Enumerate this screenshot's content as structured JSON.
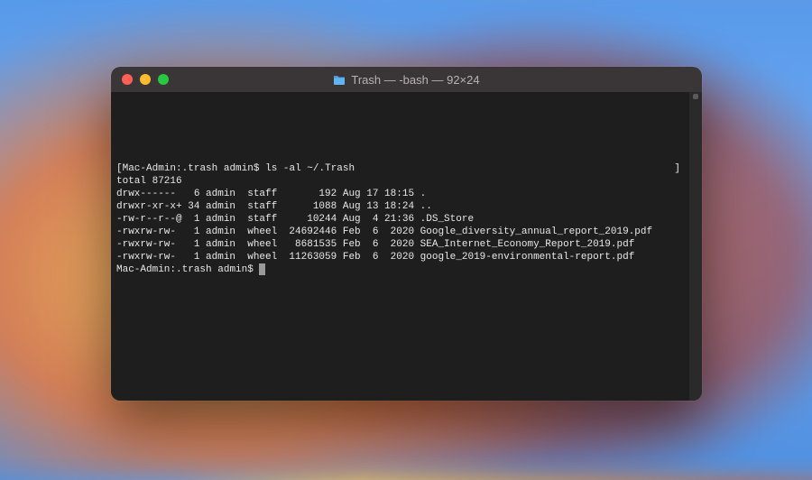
{
  "window": {
    "title": "Trash — -bash — 92×24",
    "folder_icon": "folder-icon"
  },
  "session": {
    "prompt_host": "Mac-Admin",
    "prompt_cwd": ".trash",
    "prompt_user": "admin",
    "prompt_sep": "$",
    "command": "ls -al ~/.Trash",
    "total_line": "total 87216",
    "rows": [
      {
        "perm": "drwx------",
        "links": "6",
        "owner": "admin",
        "group": "staff",
        "size": "192",
        "date": "Aug 17 18:15",
        "name": "."
      },
      {
        "perm": "drwxr-xr-x+",
        "links": "34",
        "owner": "admin",
        "group": "staff",
        "size": "1088",
        "date": "Aug 13 18:24",
        "name": ".."
      },
      {
        "perm": "-rw-r--r--@",
        "links": "1",
        "owner": "admin",
        "group": "staff",
        "size": "10244",
        "date": "Aug  4 21:36",
        "name": ".DS_Store"
      },
      {
        "perm": "-rwxrw-rw-",
        "links": "1",
        "owner": "admin",
        "group": "wheel",
        "size": "24692446",
        "date": "Feb  6  2020",
        "name": "Google_diversity_annual_report_2019.pdf"
      },
      {
        "perm": "-rwxrw-rw-",
        "links": "1",
        "owner": "admin",
        "group": "wheel",
        "size": "8681535",
        "date": "Feb  6  2020",
        "name": "SEA_Internet_Economy_Report_2019.pdf"
      },
      {
        "perm": "-rwxrw-rw-",
        "links": "1",
        "owner": "admin",
        "group": "wheel",
        "size": "11263059",
        "date": "Feb  6  2020",
        "name": "google_2019-environmental-report.pdf"
      }
    ]
  },
  "colors": {
    "term_bg": "#1e1e1e",
    "term_fg": "#e8e8e8",
    "titlebar_bg": "#3a3638"
  }
}
